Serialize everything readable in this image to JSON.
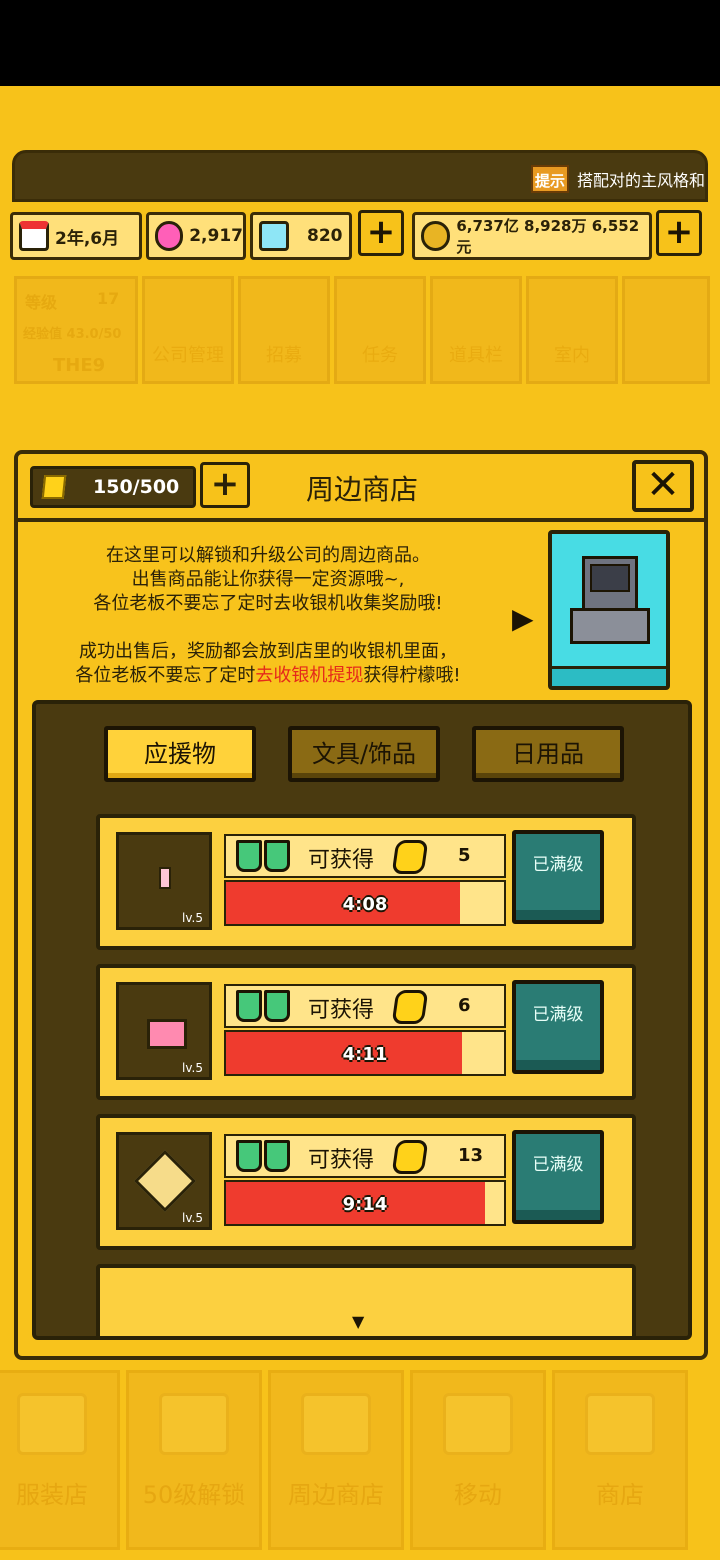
{
  "hud": {
    "tip_badge": "提示",
    "tip_text": "搭配对的主风格和",
    "date": "2年,6月",
    "gems": "2,917",
    "diamonds": "820",
    "money": "6,737亿 8,928万 6,552元",
    "plus": "+",
    "level_label": "等级",
    "level": "17",
    "exp": "经验值 43.0/50",
    "company_name": "THE9",
    "menu": [
      "公司管理",
      "招募",
      "任务",
      "道具栏",
      "室内"
    ]
  },
  "modal": {
    "lemons": "150/500",
    "plus": "+",
    "title": "周边商店",
    "close": "✕",
    "desc1": [
      "在这里可以解锁和升级公司的周边商品。",
      "出售商品能让你获得一定资源哦~,",
      "各位老板不要忘了定时去收银机收集奖励哦!"
    ],
    "desc2_line1": "成功出售后，奖励都会放到店里的收银机里面，",
    "desc2_pre": "各位老板不要忘了定时",
    "desc2_red": "去收银机提现",
    "desc2_post": "获得柠檬哦!",
    "tabs": [
      "应援物",
      "文具/饰品",
      "日用品"
    ],
    "items": [
      {
        "level": "lv.5",
        "gain_label": "可获得",
        "amount": "5",
        "time": "4:08",
        "progress": 0.84,
        "button": "已满级"
      },
      {
        "level": "lv.5",
        "gain_label": "可获得",
        "amount": "6",
        "time": "4:11",
        "progress": 0.85,
        "button": "已满级"
      },
      {
        "level": "lv.5",
        "gain_label": "可获得",
        "amount": "13",
        "time": "9:14",
        "progress": 0.93,
        "button": "已满级"
      }
    ]
  },
  "bottom_nav": [
    "服装店",
    "50级解锁",
    "周边商店",
    "移动",
    "商店"
  ]
}
